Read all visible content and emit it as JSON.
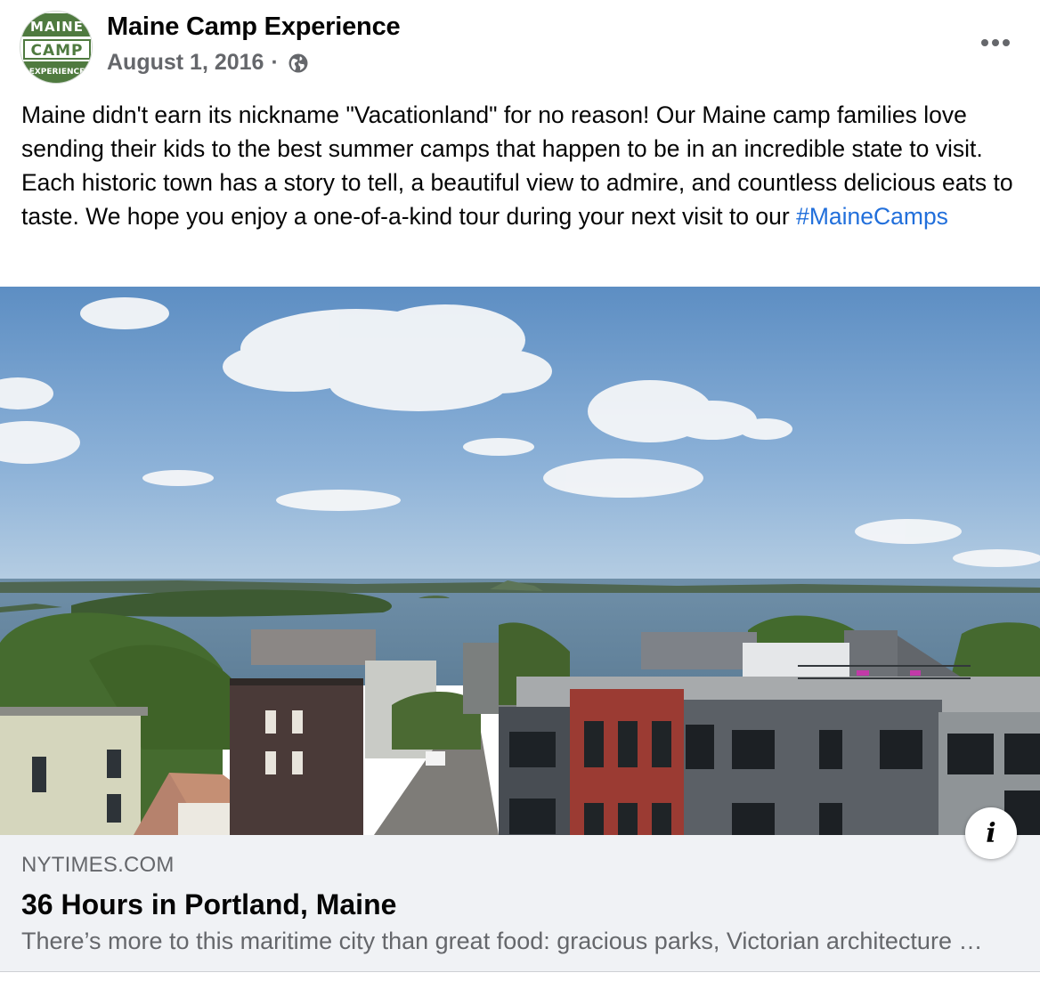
{
  "post": {
    "author": "Maine Camp Experience",
    "avatar_logo": {
      "line1": "MAINE",
      "line2": "CAMP",
      "line3": "EXPERIENCE",
      "bg_color": "#4f7a3f"
    },
    "date": "August 1, 2016",
    "separator": "·",
    "privacy_icon": "globe-icon",
    "more_icon": "more-options-icon",
    "text": "Maine didn't earn its nickname \"Vacationland\" for no reason! Our Maine camp families love sending their kids to the best summer camps that happen to be in an incredible state to visit. Each historic town has a story to tell, a beautiful view to admire, and countless delicious eats to taste. We hope you enjoy a one-of-a-kind tour during your next visit to our ",
    "hashtag": "#MaineCamps",
    "hashtag_color": "#216fdb"
  },
  "link": {
    "domain": "NYTIMES.COM",
    "title": "36 Hours in Portland, Maine",
    "description": "There’s more to this maritime city than great food: gracious parks, Victorian architecture and a thriving waterfront.",
    "info_label": "i"
  },
  "colors": {
    "secondary_text": "#65676b",
    "card_bg": "#f0f2f5"
  }
}
